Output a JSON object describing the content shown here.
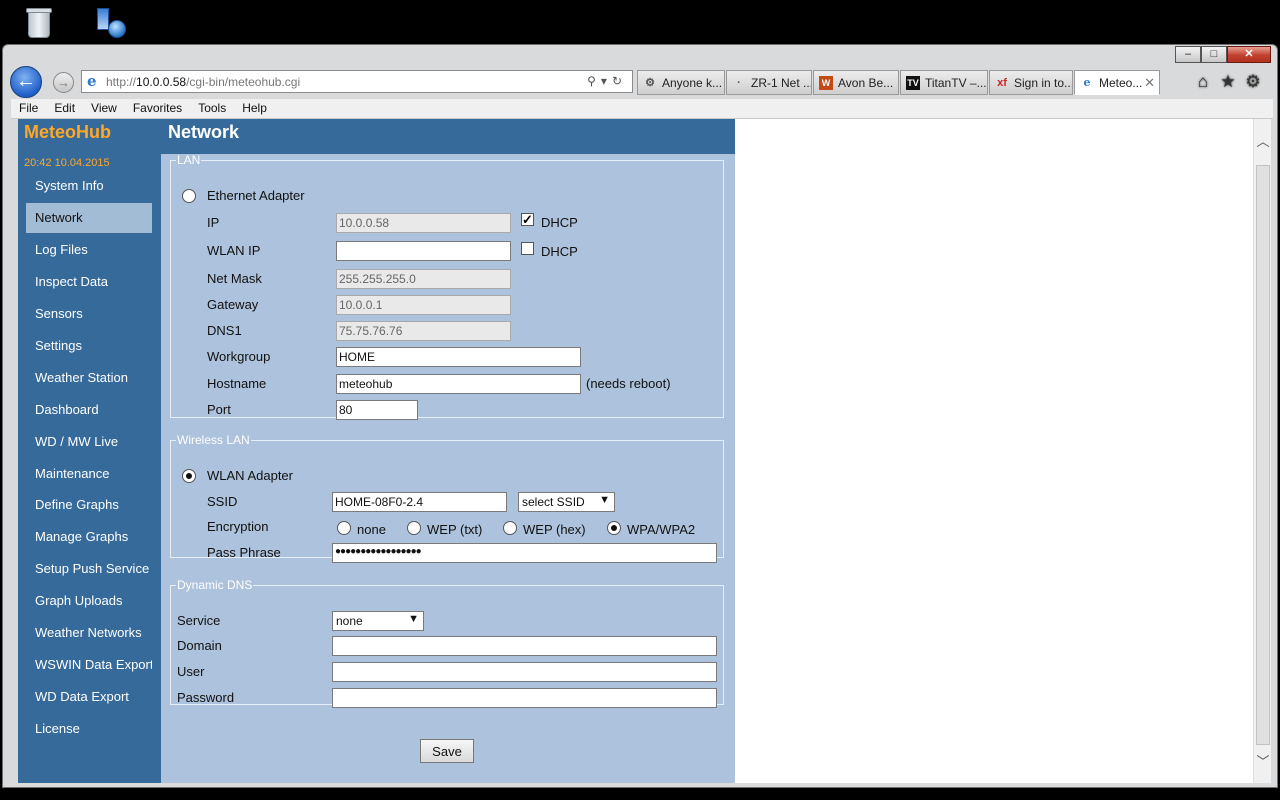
{
  "desktop": {
    "recycle_icon": "recycle-bin-icon",
    "app_icon": "network-app-icon"
  },
  "browser": {
    "url_prefix": "http://",
    "url_host": "10.0.0.58",
    "url_path": "/cgi-bin/meteohub.cgi",
    "tabs": [
      {
        "label": "Anyone k...",
        "icon": "⚙"
      },
      {
        "label": "ZR-1 Net ...",
        "icon": "·"
      },
      {
        "label": "Avon Be...",
        "icon": "W"
      },
      {
        "label": "TitanTV –...",
        "icon": "TV"
      },
      {
        "label": "Sign in to...",
        "icon": "xf"
      },
      {
        "label": "Meteo...",
        "icon": "e"
      }
    ],
    "menu": [
      "File",
      "Edit",
      "View",
      "Favorites",
      "Tools",
      "Help"
    ]
  },
  "sidebar": {
    "logo": "MeteoHub",
    "datetime": "20:42   10.04.2015",
    "items": [
      "System Info",
      "Network",
      "Log Files",
      "Inspect Data",
      "Sensors",
      "Settings",
      "Weather Station",
      "Dashboard",
      "WD / MW Live",
      "Maintenance",
      "Define Graphs",
      "Manage Graphs",
      "Setup Push Service",
      "Graph Uploads",
      "Weather Networks",
      "WSWIN Data Export",
      "WD Data Export",
      "License"
    ],
    "active": "Network"
  },
  "page": {
    "title": "Network",
    "lan": {
      "legend": "LAN",
      "adapter_label": "Ethernet Adapter",
      "ip_label": "IP",
      "ip_value": "10.0.0.58",
      "dhcp_label": "DHCP",
      "dhcp_checked": true,
      "wlan_ip_label": "WLAN IP",
      "wlan_ip_value": "",
      "dhcp2_label": "DHCP",
      "dhcp2_checked": false,
      "netmask_label": "Net Mask",
      "netmask_value": "255.255.255.0",
      "gateway_label": "Gateway",
      "gateway_value": "10.0.0.1",
      "dns1_label": "DNS1",
      "dns1_value": "75.75.76.76",
      "workgroup_label": "Workgroup",
      "workgroup_value": "HOME",
      "hostname_label": "Hostname",
      "hostname_value": "meteohub",
      "hostname_note": "(needs reboot)",
      "port_label": "Port",
      "port_value": "80"
    },
    "wlan": {
      "legend": "Wireless LAN",
      "adapter_label": "WLAN Adapter",
      "ssid_label": "SSID",
      "ssid_value": "HOME-08F0-2.4",
      "ssid_select": "select SSID",
      "encryption_label": "Encryption",
      "enc_none": "none",
      "enc_wep_txt": "WEP (txt)",
      "enc_wep_hex": "WEP (hex)",
      "enc_wpa": "WPA/WPA2",
      "enc_selected": "WPA/WPA2",
      "passphrase_label": "Pass Phrase",
      "passphrase_value": "●●●●●●●●●●●●●●●●●"
    },
    "ddns": {
      "legend": "Dynamic DNS",
      "service_label": "Service",
      "service_value": "none",
      "domain_label": "Domain",
      "domain_value": "",
      "user_label": "User",
      "user_value": "",
      "password_label": "Password",
      "password_value": ""
    },
    "save_label": "Save"
  }
}
